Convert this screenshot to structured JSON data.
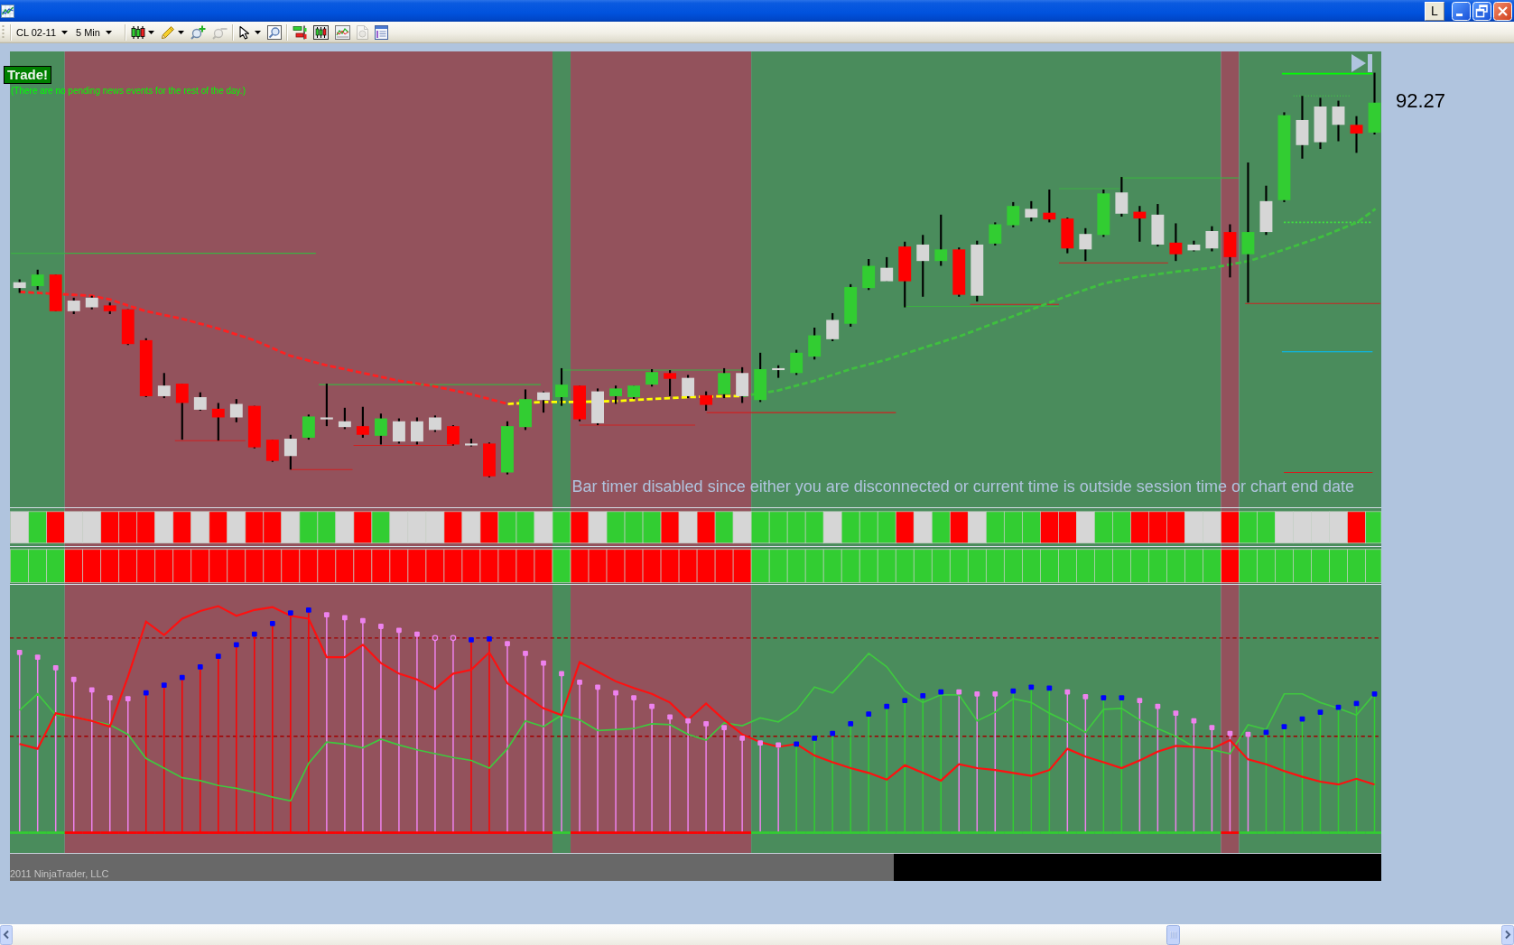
{
  "window": {
    "caption_button": "L"
  },
  "toolbar": {
    "instrument": "CL 02-11",
    "interval": "5 Min",
    "groups": [
      {
        "tools": [
          {
            "kind": "candles",
            "dropdown": true,
            "disabled": false
          },
          {
            "kind": "pencil",
            "dropdown": true,
            "disabled": false
          },
          {
            "kind": "zoomin",
            "dropdown": false,
            "disabled": false
          },
          {
            "kind": "zoomout",
            "dropdown": false,
            "disabled": true
          }
        ]
      },
      {
        "tools": [
          {
            "kind": "pointer",
            "dropdown": true,
            "disabled": false
          },
          {
            "kind": "finder",
            "dropdown": false,
            "disabled": false
          }
        ]
      },
      {
        "tools": [
          {
            "kind": "tradebars",
            "dropdown": false,
            "disabled": false
          },
          {
            "kind": "candlebox",
            "dropdown": false,
            "disabled": false
          },
          {
            "kind": "linebox",
            "dropdown": false,
            "disabled": false
          },
          {
            "kind": "document",
            "dropdown": false,
            "disabled": true
          },
          {
            "kind": "form",
            "dropdown": false,
            "disabled": false
          }
        ]
      }
    ]
  },
  "chart": {
    "signal": "Trade!",
    "news_message": "(There are no pending news events for the rest of the day.)",
    "last_price": "92.27",
    "bar_timer_message": "Bar timer disabled since either you are disconnected or current time is outside session time or chart end date",
    "copyright": "2011 NinjaTrader, LLC"
  }
}
